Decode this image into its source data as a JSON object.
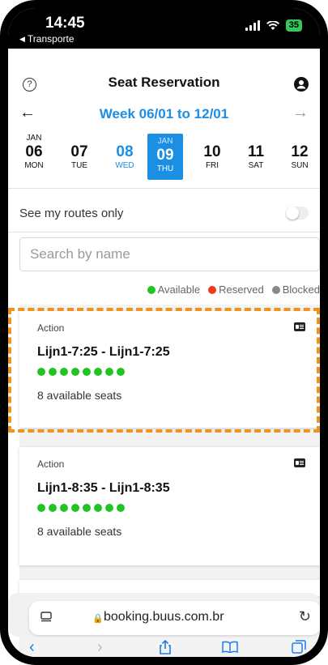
{
  "status": {
    "time": "14:45",
    "back_app": "Transporte",
    "battery": "35"
  },
  "header": {
    "title": "Seat Reservation",
    "help_symbol": "?",
    "icons": [
      "help-icon",
      "profile-icon"
    ]
  },
  "week": {
    "label": "Week 06/01 to 12/01",
    "prev_symbol": "←",
    "next_symbol": "→"
  },
  "days": [
    {
      "month": "JAN",
      "day": "06",
      "weekday": "MON"
    },
    {
      "month": "",
      "day": "07",
      "weekday": "TUE"
    },
    {
      "month": "",
      "day": "08",
      "weekday": "WED"
    },
    {
      "month": "JAN",
      "day": "09",
      "weekday": "THU"
    },
    {
      "month": "",
      "day": "10",
      "weekday": "FRI"
    },
    {
      "month": "",
      "day": "11",
      "weekday": "SAT"
    },
    {
      "month": "",
      "day": "12",
      "weekday": "SUN"
    }
  ],
  "selected_day": "09",
  "filters": {
    "routes_only_label": "See my routes only",
    "routes_only_enabled": false,
    "search_placeholder": "Search by name"
  },
  "legend": [
    {
      "label": "Available",
      "color": "#22c322"
    },
    {
      "label": "Reserved",
      "color": "#f2391e"
    },
    {
      "label": "Blocked",
      "color": "#888888"
    }
  ],
  "cards": [
    {
      "type": "Action",
      "title": "Lijn1-7:25 - Lijn1-7:25",
      "seats_available": 8,
      "availability_text": "8 available seats"
    },
    {
      "type": "Action",
      "title": "Lijn1-8:35 - Lijn1-8:35",
      "seats_available": 8,
      "availability_text": "8 available seats"
    }
  ],
  "browser": {
    "url": "booking.buus.com.br",
    "lock_symbol": "🔒",
    "reload_symbol": "↻"
  },
  "colors": {
    "accent": "#1a8fe3",
    "highlight": "#f0921e",
    "seat_available": "#22c322"
  }
}
